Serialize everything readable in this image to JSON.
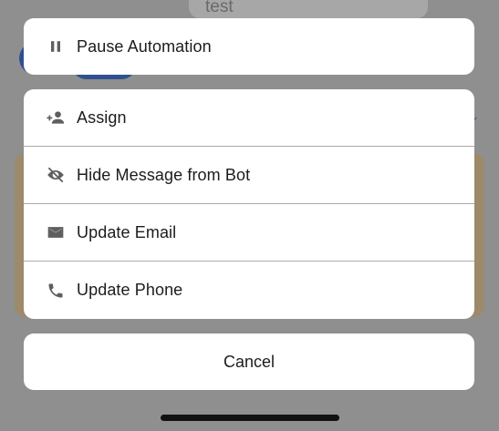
{
  "background": {
    "bubble_text": "test"
  },
  "sheet": {
    "top_group": {
      "pause": {
        "label": "Pause Automation",
        "icon": "pause-icon"
      }
    },
    "main_group": {
      "items": [
        {
          "label": "Assign",
          "icon": "person-add-icon"
        },
        {
          "label": "Hide Message from Bot",
          "icon": "eye-off-icon"
        },
        {
          "label": "Update Email",
          "icon": "envelope-icon"
        },
        {
          "label": "Update Phone",
          "icon": "phone-icon"
        }
      ]
    },
    "cancel": {
      "label": "Cancel"
    }
  },
  "colors": {
    "overlay": "#8f8f8f",
    "sheet_bg": "#ffffff",
    "icon": "#5f5f5f",
    "text": "#1c1c1c",
    "separator": "#aeaaa4"
  }
}
